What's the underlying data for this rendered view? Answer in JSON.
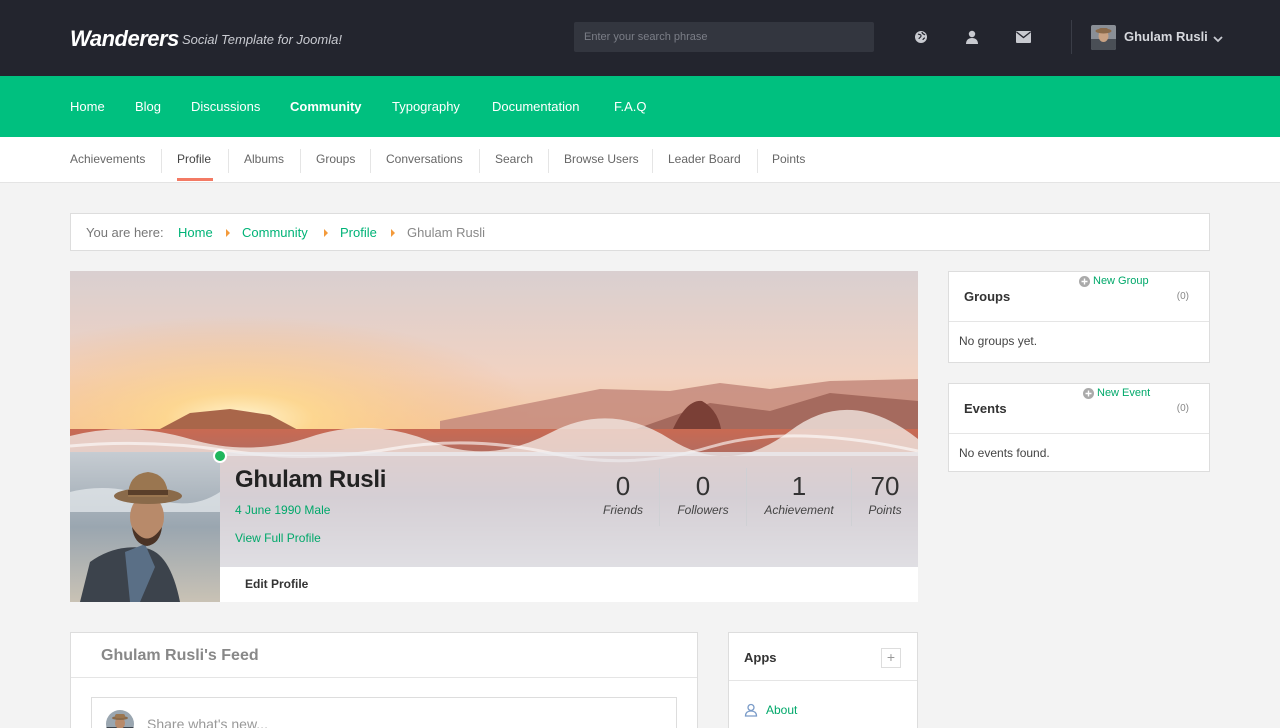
{
  "header": {
    "logo": "Wanderers",
    "tagline": "Social Template for Joomla!",
    "search_placeholder": "Enter your search phrase",
    "user_name": "Ghulam Rusli"
  },
  "main_nav": {
    "items": [
      {
        "label": "Home",
        "active": false
      },
      {
        "label": "Blog",
        "active": false
      },
      {
        "label": "Discussions",
        "active": false
      },
      {
        "label": "Community",
        "active": true
      },
      {
        "label": "Typography",
        "active": false
      },
      {
        "label": "Documentation",
        "active": false
      },
      {
        "label": "F.A.Q",
        "active": false
      }
    ]
  },
  "sub_nav": {
    "items": [
      {
        "label": "Achievements",
        "active": false
      },
      {
        "label": "Profile",
        "active": true
      },
      {
        "label": "Albums",
        "active": false
      },
      {
        "label": "Groups",
        "active": false
      },
      {
        "label": "Conversations",
        "active": false
      },
      {
        "label": "Search",
        "active": false
      },
      {
        "label": "Browse Users",
        "active": false
      },
      {
        "label": "Leader Board",
        "active": false
      },
      {
        "label": "Points",
        "active": false
      }
    ]
  },
  "breadcrumb": {
    "label": "You are here:",
    "items": [
      "Home",
      "Community",
      "Profile"
    ],
    "current": "Ghulam Rusli"
  },
  "profile": {
    "name": "Ghulam Rusli",
    "meta": "4 June 1990 Male",
    "view_link": "View Full Profile",
    "edit_label": "Edit Profile",
    "stats": [
      {
        "value": "0",
        "label": "Friends"
      },
      {
        "value": "0",
        "label": "Followers"
      },
      {
        "value": "1",
        "label": "Achievement"
      },
      {
        "value": "70",
        "label": "Points"
      }
    ]
  },
  "groups": {
    "title": "Groups",
    "new_label": "New Group",
    "count": "(0)",
    "empty": "No groups yet."
  },
  "events": {
    "title": "Events",
    "new_label": "New Event",
    "count": "(0)",
    "empty": "No events found."
  },
  "feed": {
    "title": "Ghulam Rusli's Feed",
    "share_placeholder": "Share what's new..."
  },
  "apps": {
    "title": "Apps",
    "plus": "+",
    "items": [
      "About"
    ]
  },
  "colors": {
    "accent": "#00c07f",
    "topbar": "#23252e",
    "link": "#00a86a",
    "active_tab": "#f37a64"
  }
}
